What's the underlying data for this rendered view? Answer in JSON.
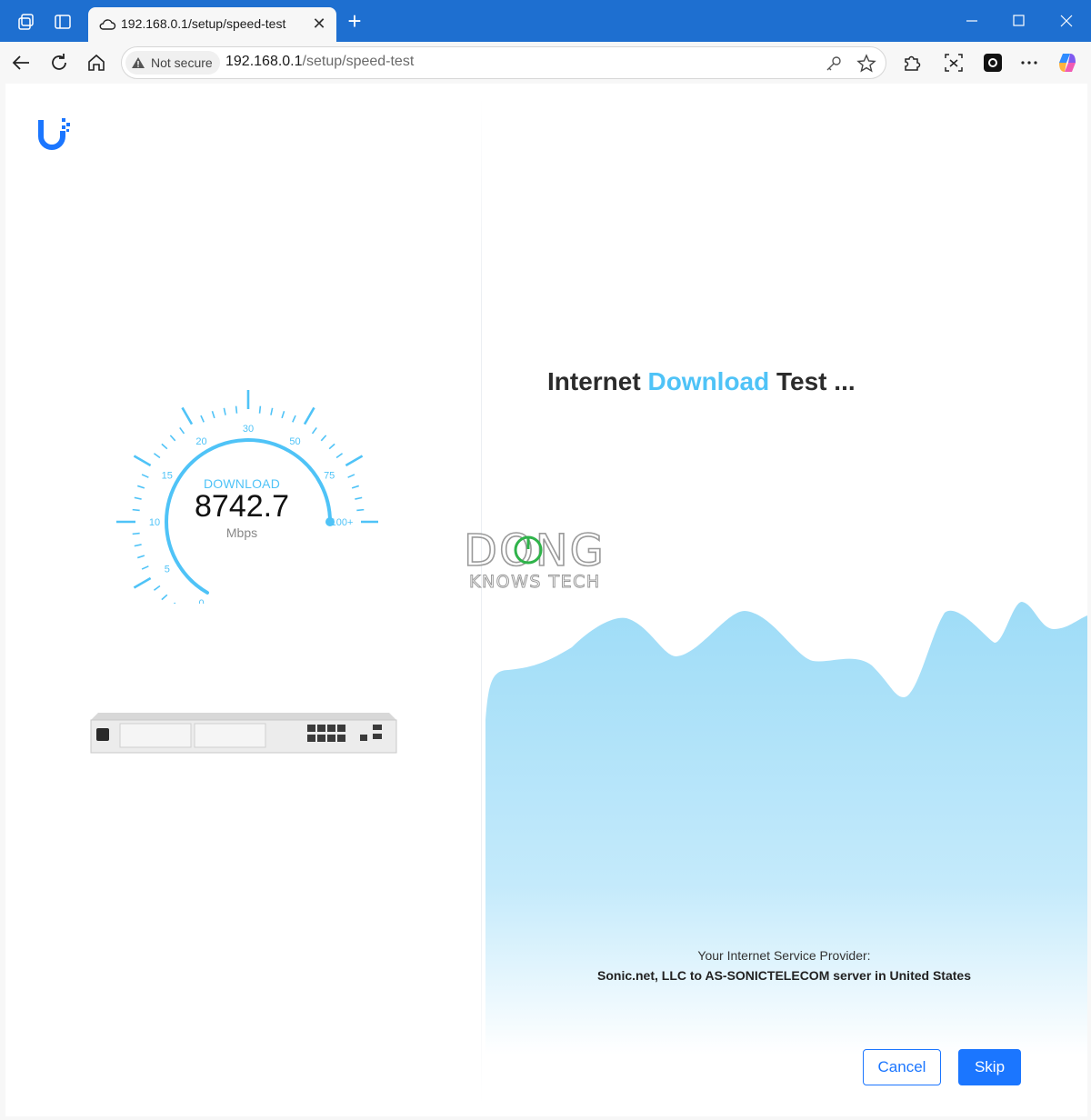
{
  "browser": {
    "tab_title": "192.168.0.1/setup/speed-test",
    "security_label": "Not secure",
    "url_host": "192.168.0.1",
    "url_path": "/setup/speed-test"
  },
  "speedtest": {
    "gauge_label": "DOWNLOAD",
    "value": "8742.7",
    "unit": "Mbps",
    "scale_labels": [
      "0",
      "5",
      "10",
      "15",
      "20",
      "30",
      "50",
      "75",
      "100+"
    ],
    "gauge_fill_fraction": 1.0
  },
  "heading": {
    "part1": "Internet ",
    "highlight": "Download",
    "part2": " Test ..."
  },
  "watermark": {
    "line1": "DONG",
    "line2": "KNOWS TECH"
  },
  "isp": {
    "label": "Your Internet Service Provider:",
    "value": "Sonic.net, LLC to AS-SONICTELECOM server in United States"
  },
  "actions": {
    "cancel_label": "Cancel",
    "skip_label": "Skip"
  },
  "colors": {
    "titlebar": "#1e6fd0",
    "accent": "#4fc3f7",
    "button_primary": "#1b76ff",
    "logo": "#1b76ff"
  }
}
